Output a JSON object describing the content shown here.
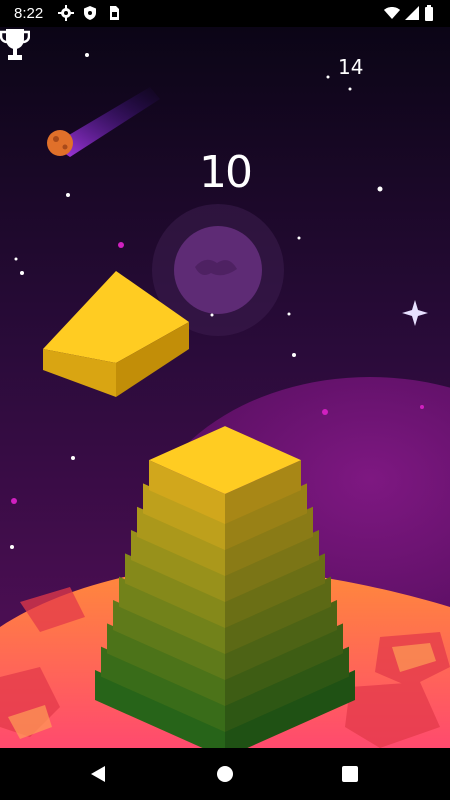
{
  "status_bar": {
    "time": "8:22",
    "left_icons": [
      "gear-icon",
      "shield-icon",
      "sim-card-icon"
    ],
    "right_icons": [
      "wifi-icon",
      "signal-icon",
      "battery-icon"
    ]
  },
  "game": {
    "score": "10",
    "best_score": "14",
    "best_icon": "trophy-icon",
    "stack_levels": 10,
    "block_color_top": "#ffcc22",
    "block_color_bottom": "#2f7a1e",
    "sky_color_top": "#0b0516",
    "sky_color_bottom": "#5a0f5e",
    "planet_color": "#ff6b3d"
  },
  "nav_bar": {
    "buttons": [
      "back-icon",
      "home-icon",
      "recents-icon"
    ]
  }
}
